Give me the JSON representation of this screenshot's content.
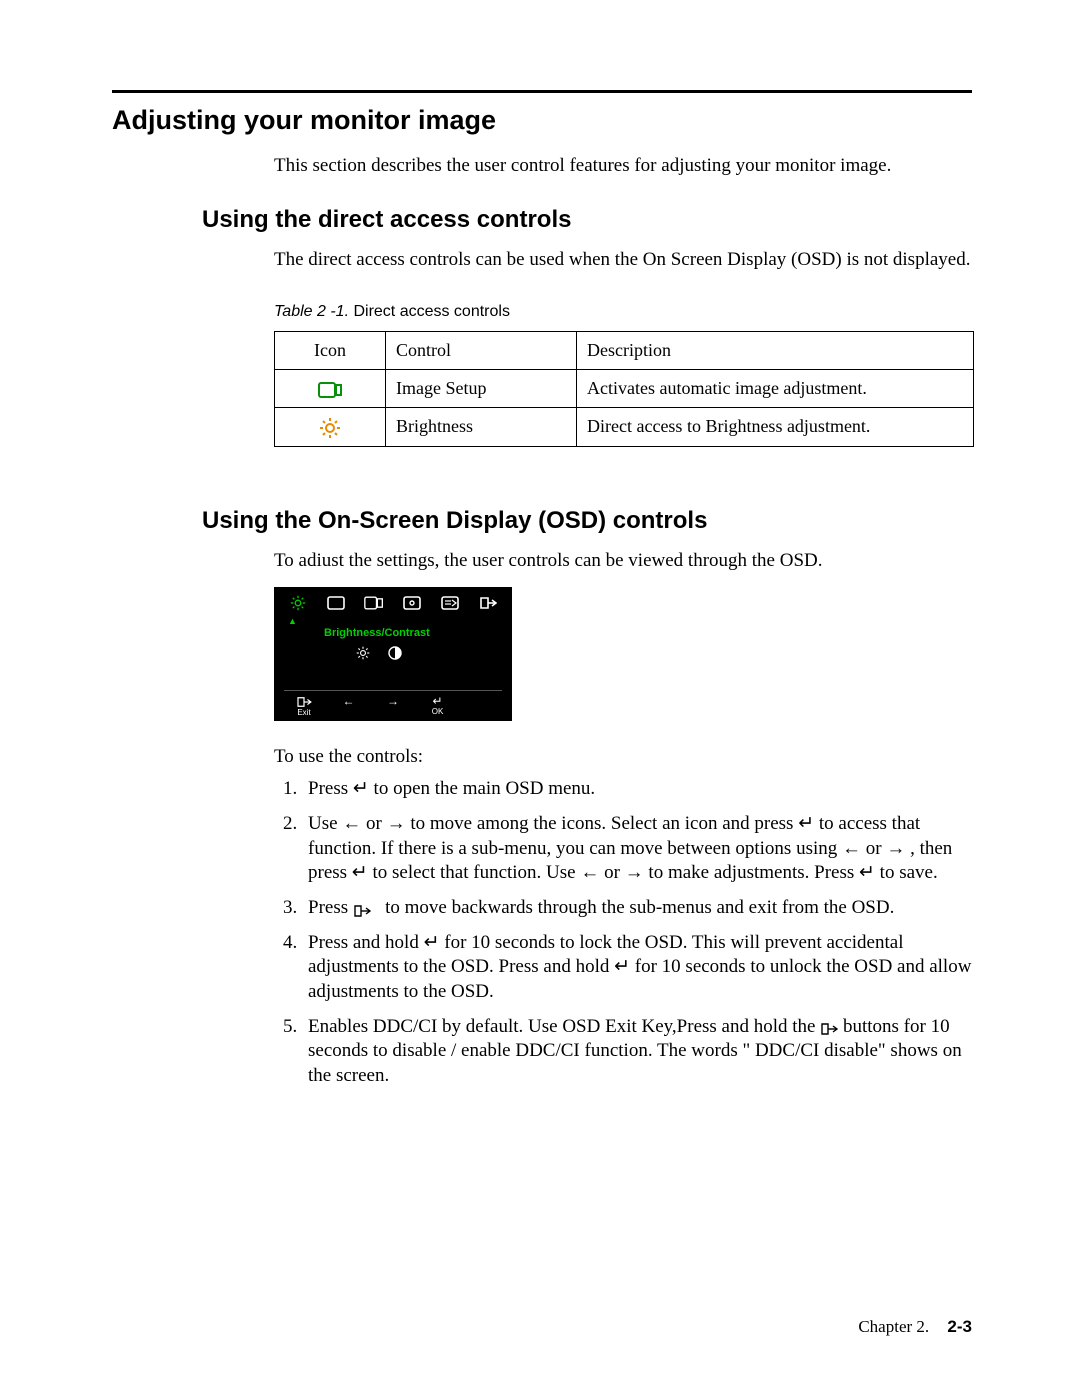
{
  "section_title": "Adjusting your monitor image",
  "intro": "This section describes the user control features for adjusting your monitor image.",
  "sub1_title": "Using the direct access controls",
  "sub1_intro": "The direct access controls can be used when the On Screen Display (OSD) is not displayed.",
  "table_caption_label": "Table 2 -1.",
  "table_caption_text": " Direct access controls",
  "table_headers": {
    "icon": "Icon",
    "control": "Control",
    "description": "Description"
  },
  "table_rows": [
    {
      "icon_name": "image-setup-icon",
      "control": "Image Setup",
      "description": "Activates automatic image adjustment."
    },
    {
      "icon_name": "brightness-icon",
      "control": "Brightness",
      "description": "Direct access to Brightness adjustment."
    }
  ],
  "sub2_title": "Using the On-Screen Display (OSD) controls",
  "sub2_intro": "To adiust the settings, the user controls can be viewed through the OSD.",
  "osd": {
    "active_label": "Brightness/Contrast",
    "exit_label": "Exit",
    "ok_label": "OK"
  },
  "steps_intro": "To use the controls:",
  "steps": [
    "Press ↵ to open the main OSD menu.",
    "Use ← or → to move among the icons. Select an icon and press ↵ to access that function. If there is a sub-menu, you can move between options using ← or → , then press ↵ to select that function. Use ← or → to make adjustments. Press ↵ to save.",
    "Press      to move backwards through the sub-menus and exit from the OSD.",
    "Press and hold ↵  for 10 seconds to lock the OSD. This will prevent accidental adjustments to the OSD. Press and hold ↵  for 10  seconds to unlock the OSD and allow adjustments to the OSD.",
    "Enables DDC/CI by default. Use OSD Exit Key,Press and hold the       buttons  for 10 seconds to disable / enable DDC/CI function. The words \" DDC/CI disable\" shows on the screen."
  ],
  "footer_chapter": "Chapter 2.",
  "footer_page": "2-3"
}
